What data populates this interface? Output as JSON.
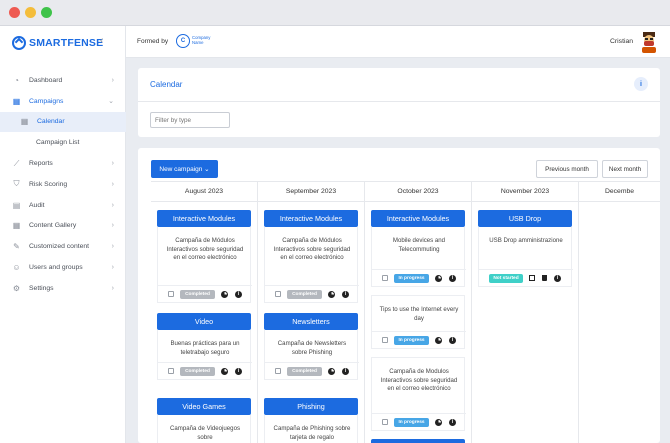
{
  "app": {
    "brand": "SMARTFENSE",
    "collapse_icon": "chevron-left"
  },
  "header": {
    "formed_by": "Formed by",
    "company_logo_letter": "C",
    "company_name": "Company Name",
    "username": "Cristian"
  },
  "sidebar": {
    "items": [
      {
        "label": "Dashboard",
        "icon": "dashboard-icon"
      },
      {
        "label": "Campaigns",
        "icon": "calendar-icon"
      },
      {
        "label": "Calendar",
        "icon": "calendar-small-icon"
      },
      {
        "label": "Campaign List"
      },
      {
        "label": "Reports",
        "icon": "chart-icon"
      },
      {
        "label": "Risk Scoring",
        "icon": "shield-icon"
      },
      {
        "label": "Audit",
        "icon": "audit-icon"
      },
      {
        "label": "Content Gallery",
        "icon": "gallery-icon"
      },
      {
        "label": "Customized content",
        "icon": "edit-icon"
      },
      {
        "label": "Users and groups",
        "icon": "users-icon"
      },
      {
        "label": "Settings",
        "icon": "gear-icon"
      }
    ]
  },
  "page": {
    "title": "Calendar",
    "filter_placeholder": "Filter by type",
    "new_campaign": "New campaign ⌄",
    "prev_month": "Previous month",
    "next_month": "Next month"
  },
  "calendar": {
    "months": [
      "August 2023",
      "September 2023",
      "October 2023",
      "November 2023",
      "Decembe"
    ],
    "aug": {
      "t1": "Interactive Modules",
      "c1": "Campaña de Módulos Interactivos sobre seguridad en el correo electrónico",
      "s1": "Completed",
      "t2": "Video",
      "c2": "Buenas prácticas para un teletrabajo seguro",
      "s2": "Completed",
      "t3": "Video Games",
      "c3": "Campaña de Videojuegos sobre"
    },
    "sep": {
      "t1": "Interactive Modules",
      "c1": "Campaña de Módulos Interactivos sobre seguridad en el correo electrónico",
      "s1": "Completed",
      "t2": "Newsletters",
      "c2": "Campaña de Newsletters sobre Phishing",
      "s2": "Completed",
      "t3": "Phishing",
      "c3": "Campaña de Phishing sobre tarjeta de regalo"
    },
    "oct": {
      "t1": "Interactive Modules",
      "c1": "Mobile devices and Telecommuting",
      "s1": "In progress",
      "c2": "Tips to use the Internet every day",
      "s2": "In progress",
      "c3": "Campaña de Modulos Interactivos sobre seguridad en el correo electrónico",
      "s3": "In progress"
    },
    "nov": {
      "t1": "USB Drop",
      "c1": "USB Drop amministrazione",
      "s1": "Not started"
    }
  },
  "colors": {
    "accent": "#1c6be0",
    "completed": "#b4b8be",
    "in_progress": "#47a6e6",
    "not_started": "#3fd0c8"
  }
}
